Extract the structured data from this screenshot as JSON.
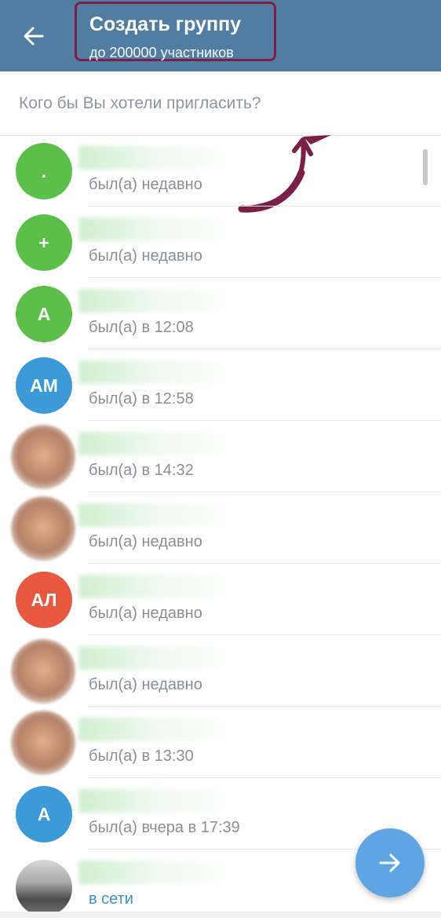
{
  "header": {
    "title": "Создать группу",
    "subtitle": "до 200000 участников",
    "background_color": "#527da3",
    "highlight_color": "#7a1f47",
    "back_icon": "arrow-left-icon"
  },
  "search": {
    "placeholder": "Кого бы Вы хотели пригласить?",
    "value": ""
  },
  "contacts": [
    {
      "avatar_text": ".",
      "avatar_color": "#5cbf4a",
      "status": "был(а) недавно"
    },
    {
      "avatar_text": "+",
      "avatar_color": "#5cbf4a",
      "status": "был(а) недавно"
    },
    {
      "avatar_text": "А",
      "avatar_color": "#5cbf4a",
      "status": "был(а) в 12:08"
    },
    {
      "avatar_text": "АМ",
      "avatar_color": "#3d9ad9",
      "status": "был(а) в 12:58"
    },
    {
      "avatar_text": "",
      "avatar_color": "photo",
      "status": "был(а) в 14:32"
    },
    {
      "avatar_text": "",
      "avatar_color": "photo",
      "status": "был(а) недавно"
    },
    {
      "avatar_text": "АЛ",
      "avatar_color": "#e8573f",
      "status": "был(а) недавно"
    },
    {
      "avatar_text": "",
      "avatar_color": "photo",
      "status": "был(а) недавно"
    },
    {
      "avatar_text": "",
      "avatar_color": "photo",
      "status": "был(а) в 13:30"
    },
    {
      "avatar_text": "А",
      "avatar_color": "#3d9ad9",
      "status": "был(а) вчера в 17:39"
    },
    {
      "avatar_text": "",
      "avatar_color": "real",
      "status": "в сети",
      "online": true
    }
  ],
  "fab": {
    "icon": "arrow-right-icon",
    "color": "#5fa5e4"
  },
  "annotation_color": "#7a1f47"
}
